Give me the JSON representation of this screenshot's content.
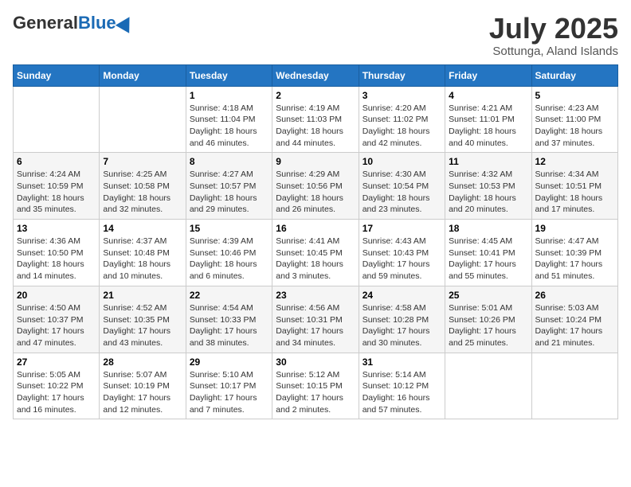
{
  "header": {
    "logo_general": "General",
    "logo_blue": "Blue",
    "month_title": "July 2025",
    "subtitle": "Sottunga, Aland Islands"
  },
  "days_of_week": [
    "Sunday",
    "Monday",
    "Tuesday",
    "Wednesday",
    "Thursday",
    "Friday",
    "Saturday"
  ],
  "weeks": [
    [
      {
        "day": "",
        "info": ""
      },
      {
        "day": "",
        "info": ""
      },
      {
        "day": "1",
        "info": "Sunrise: 4:18 AM\nSunset: 11:04 PM\nDaylight: 18 hours and 46 minutes."
      },
      {
        "day": "2",
        "info": "Sunrise: 4:19 AM\nSunset: 11:03 PM\nDaylight: 18 hours and 44 minutes."
      },
      {
        "day": "3",
        "info": "Sunrise: 4:20 AM\nSunset: 11:02 PM\nDaylight: 18 hours and 42 minutes."
      },
      {
        "day": "4",
        "info": "Sunrise: 4:21 AM\nSunset: 11:01 PM\nDaylight: 18 hours and 40 minutes."
      },
      {
        "day": "5",
        "info": "Sunrise: 4:23 AM\nSunset: 11:00 PM\nDaylight: 18 hours and 37 minutes."
      }
    ],
    [
      {
        "day": "6",
        "info": "Sunrise: 4:24 AM\nSunset: 10:59 PM\nDaylight: 18 hours and 35 minutes."
      },
      {
        "day": "7",
        "info": "Sunrise: 4:25 AM\nSunset: 10:58 PM\nDaylight: 18 hours and 32 minutes."
      },
      {
        "day": "8",
        "info": "Sunrise: 4:27 AM\nSunset: 10:57 PM\nDaylight: 18 hours and 29 minutes."
      },
      {
        "day": "9",
        "info": "Sunrise: 4:29 AM\nSunset: 10:56 PM\nDaylight: 18 hours and 26 minutes."
      },
      {
        "day": "10",
        "info": "Sunrise: 4:30 AM\nSunset: 10:54 PM\nDaylight: 18 hours and 23 minutes."
      },
      {
        "day": "11",
        "info": "Sunrise: 4:32 AM\nSunset: 10:53 PM\nDaylight: 18 hours and 20 minutes."
      },
      {
        "day": "12",
        "info": "Sunrise: 4:34 AM\nSunset: 10:51 PM\nDaylight: 18 hours and 17 minutes."
      }
    ],
    [
      {
        "day": "13",
        "info": "Sunrise: 4:36 AM\nSunset: 10:50 PM\nDaylight: 18 hours and 14 minutes."
      },
      {
        "day": "14",
        "info": "Sunrise: 4:37 AM\nSunset: 10:48 PM\nDaylight: 18 hours and 10 minutes."
      },
      {
        "day": "15",
        "info": "Sunrise: 4:39 AM\nSunset: 10:46 PM\nDaylight: 18 hours and 6 minutes."
      },
      {
        "day": "16",
        "info": "Sunrise: 4:41 AM\nSunset: 10:45 PM\nDaylight: 18 hours and 3 minutes."
      },
      {
        "day": "17",
        "info": "Sunrise: 4:43 AM\nSunset: 10:43 PM\nDaylight: 17 hours and 59 minutes."
      },
      {
        "day": "18",
        "info": "Sunrise: 4:45 AM\nSunset: 10:41 PM\nDaylight: 17 hours and 55 minutes."
      },
      {
        "day": "19",
        "info": "Sunrise: 4:47 AM\nSunset: 10:39 PM\nDaylight: 17 hours and 51 minutes."
      }
    ],
    [
      {
        "day": "20",
        "info": "Sunrise: 4:50 AM\nSunset: 10:37 PM\nDaylight: 17 hours and 47 minutes."
      },
      {
        "day": "21",
        "info": "Sunrise: 4:52 AM\nSunset: 10:35 PM\nDaylight: 17 hours and 43 minutes."
      },
      {
        "day": "22",
        "info": "Sunrise: 4:54 AM\nSunset: 10:33 PM\nDaylight: 17 hours and 38 minutes."
      },
      {
        "day": "23",
        "info": "Sunrise: 4:56 AM\nSunset: 10:31 PM\nDaylight: 17 hours and 34 minutes."
      },
      {
        "day": "24",
        "info": "Sunrise: 4:58 AM\nSunset: 10:28 PM\nDaylight: 17 hours and 30 minutes."
      },
      {
        "day": "25",
        "info": "Sunrise: 5:01 AM\nSunset: 10:26 PM\nDaylight: 17 hours and 25 minutes."
      },
      {
        "day": "26",
        "info": "Sunrise: 5:03 AM\nSunset: 10:24 PM\nDaylight: 17 hours and 21 minutes."
      }
    ],
    [
      {
        "day": "27",
        "info": "Sunrise: 5:05 AM\nSunset: 10:22 PM\nDaylight: 17 hours and 16 minutes."
      },
      {
        "day": "28",
        "info": "Sunrise: 5:07 AM\nSunset: 10:19 PM\nDaylight: 17 hours and 12 minutes."
      },
      {
        "day": "29",
        "info": "Sunrise: 5:10 AM\nSunset: 10:17 PM\nDaylight: 17 hours and 7 minutes."
      },
      {
        "day": "30",
        "info": "Sunrise: 5:12 AM\nSunset: 10:15 PM\nDaylight: 17 hours and 2 minutes."
      },
      {
        "day": "31",
        "info": "Sunrise: 5:14 AM\nSunset: 10:12 PM\nDaylight: 16 hours and 57 minutes."
      },
      {
        "day": "",
        "info": ""
      },
      {
        "day": "",
        "info": ""
      }
    ]
  ]
}
